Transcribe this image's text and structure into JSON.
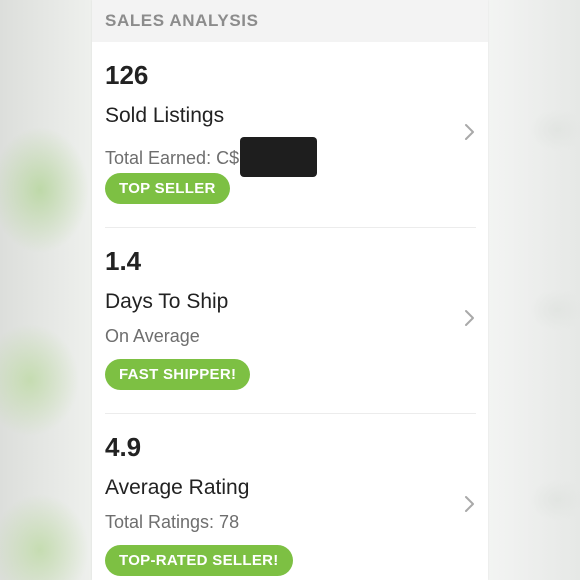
{
  "section": {
    "title": "SALES ANALYSIS"
  },
  "stats": [
    {
      "value": "126",
      "title": "Sold Listings",
      "subtitle": "Total Earned: C$",
      "redacted": true,
      "badge": "TOP SELLER"
    },
    {
      "value": "1.4",
      "title": "Days To Ship",
      "subtitle": "On Average",
      "redacted": false,
      "badge": "FAST SHIPPER!"
    },
    {
      "value": "4.9",
      "title": "Average Rating",
      "subtitle": "Total Ratings: 78",
      "redacted": false,
      "badge": "TOP-RATED SELLER!"
    }
  ],
  "icons": {
    "row_chevron": "chevron-right-icon"
  },
  "colors": {
    "badge": "#7dc043",
    "header_bg": "#f3f3f3",
    "header_text": "#8c8c8c",
    "redaction": "#1e1e1e"
  }
}
